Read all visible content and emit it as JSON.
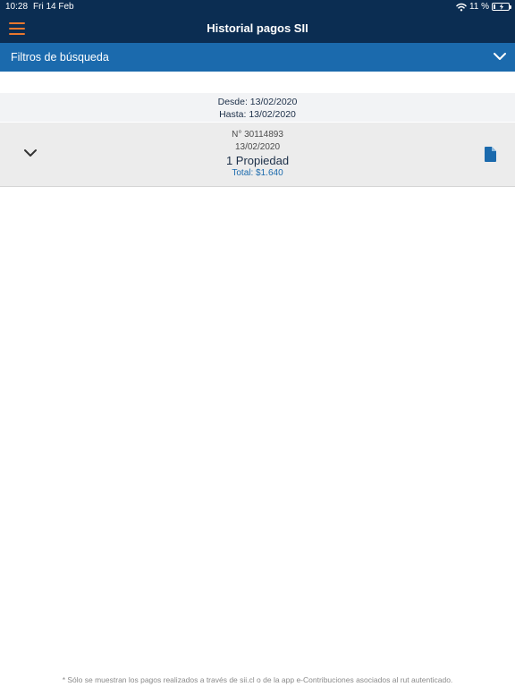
{
  "status_bar": {
    "time": "10:28",
    "date": "Fri 14 Feb",
    "battery_percent": "11 %",
    "battery_level": 0.11,
    "icons": [
      "wifi-icon",
      "battery-charging-icon"
    ]
  },
  "header": {
    "title": "Historial pagos SII",
    "menu_icon": "hamburger-menu-icon",
    "menu_color": "#e8772e",
    "background": "#0b2d52"
  },
  "filters": {
    "label": "Filtros de búsqueda",
    "icon": "chevron-down-icon",
    "background": "#1b6aad"
  },
  "date_range": {
    "from": "Desde: 13/02/2020",
    "to": "Hasta: 13/02/2020"
  },
  "payments": [
    {
      "number": "N° 30114893",
      "date": "13/02/2020",
      "description": "1 Propiedad",
      "total": "Total: $1.640",
      "expand_icon": "chevron-down-icon",
      "document_icon": "document-icon"
    }
  ],
  "footnote": "* Sólo se muestran los pagos realizados a través de sii.cl o de la app e-Contribuciones asociados al rut autenticado."
}
